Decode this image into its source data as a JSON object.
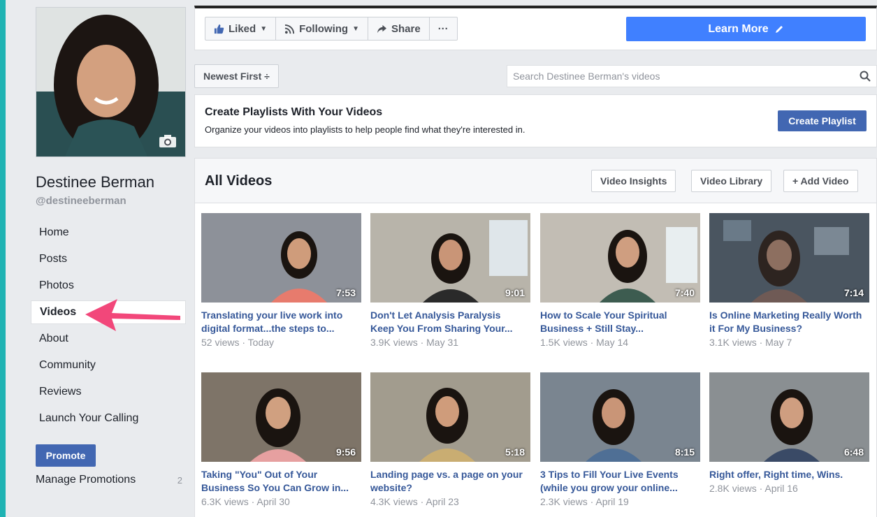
{
  "page": {
    "name": "Destinee Berman",
    "handle": "@destineeberman"
  },
  "nav": {
    "items": [
      {
        "label": "Home"
      },
      {
        "label": "Posts"
      },
      {
        "label": "Photos"
      },
      {
        "label": "Videos",
        "active": true
      },
      {
        "label": "About"
      },
      {
        "label": "Community"
      },
      {
        "label": "Reviews"
      },
      {
        "label": "Launch Your Calling"
      }
    ],
    "promote_label": "Promote",
    "manage_label": "Manage Promotions",
    "manage_count": "2"
  },
  "toolbar": {
    "liked_label": "Liked",
    "following_label": "Following",
    "share_label": "Share",
    "more_label": "···",
    "learn_more_label": "Learn More"
  },
  "filters": {
    "sort_label": "Newest First ÷",
    "search_placeholder": "Search Destinee Berman's videos"
  },
  "playlist_promo": {
    "title": "Create Playlists With Your Videos",
    "description": "Organize your videos into playlists to help people find what they're interested in.",
    "button_label": "Create Playlist"
  },
  "videos": {
    "title": "All Videos",
    "insights_label": "Video Insights",
    "library_label": "Video Library",
    "add_label": "+ Add Video",
    "items": [
      {
        "title_line1": "Translating your live work into",
        "title_line2": "digital format...the steps to...",
        "meta": "52 views · Today",
        "duration": "7:53",
        "bg": "#8d9199",
        "shirt": "#e77b6d"
      },
      {
        "title_line1": "Don't Let Analysis Paralysis",
        "title_line2": "Keep You From Sharing Your...",
        "meta": "3.9K views · May 31",
        "duration": "9:01",
        "bg": "#b8b4aa",
        "shirt": "#2a2a2a"
      },
      {
        "title_line1": "How to Scale Your Spiritual",
        "title_line2": "Business + Still Stay...",
        "meta": "1.5K views · May 14",
        "duration": "7:40",
        "bg": "#c2bdb4",
        "shirt": "#3d5c50"
      },
      {
        "title_line1": "Is Online Marketing Really Worth",
        "title_line2": "it For My Business?",
        "meta": "3.1K views · May 7",
        "duration": "7:14",
        "bg": "#4a5560",
        "shirt": "#6f5a55"
      },
      {
        "title_line1": "Taking \"You\" Out of Your",
        "title_line2": "Business So You Can Grow in...",
        "meta": "6.3K views · April 30",
        "duration": "9:56",
        "bg": "#7e7468",
        "shirt": "#e6a0a0"
      },
      {
        "title_line1": "Landing page vs. a page on your",
        "title_line2": "website?",
        "meta": "4.3K views · April 23",
        "duration": "5:18",
        "bg": "#a29c8e",
        "shirt": "#c9ad72"
      },
      {
        "title_line1": "3 Tips to Fill Your Live Events",
        "title_line2": "(while you grow your online...",
        "meta": "2.3K views · April 19",
        "duration": "8:15",
        "bg": "#7a8590",
        "shirt": "#4f6f95"
      },
      {
        "title_line1": "Right offer, Right time, Wins.",
        "title_line2": "",
        "meta": "2.8K views · April 16",
        "duration": "6:48",
        "bg": "#8a8f92",
        "shirt": "#3a4a66"
      }
    ]
  },
  "colors": {
    "accent": "#4267b2",
    "learn_more": "#4080ff",
    "link": "#365899",
    "arrow": "#f2477a"
  }
}
